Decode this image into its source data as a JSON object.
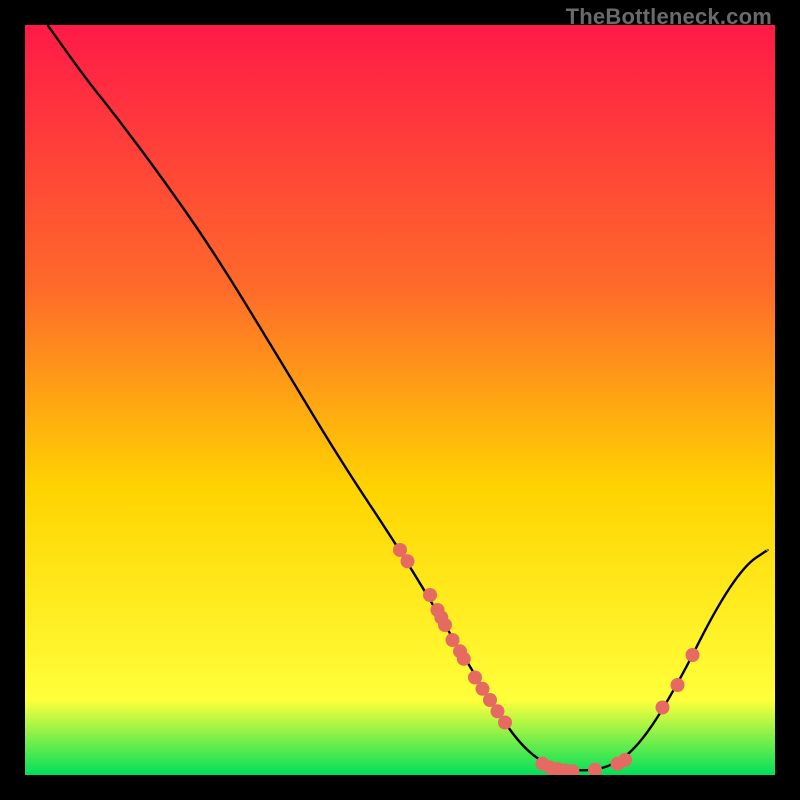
{
  "watermark": "TheBottleneck.com",
  "colors": {
    "black": "#000000",
    "curve": "#000000",
    "point": "#e56a61",
    "grad_top": "#ff1a47",
    "grad_mid1": "#ff6a2a",
    "grad_mid2": "#ffd400",
    "grad_mid3": "#ffff3a",
    "grad_bottom": "#00e05a"
  },
  "chart_data": {
    "type": "line",
    "title": "",
    "xlabel": "",
    "ylabel": "",
    "xlim": [
      0,
      100
    ],
    "ylim": [
      0,
      100
    ],
    "curve": [
      {
        "x": 3,
        "y": 100
      },
      {
        "x": 8,
        "y": 93
      },
      {
        "x": 12,
        "y": 88
      },
      {
        "x": 18,
        "y": 80
      },
      {
        "x": 25,
        "y": 70
      },
      {
        "x": 33,
        "y": 57
      },
      {
        "x": 42,
        "y": 42
      },
      {
        "x": 50,
        "y": 30
      },
      {
        "x": 56,
        "y": 20
      },
      {
        "x": 62,
        "y": 10
      },
      {
        "x": 66,
        "y": 4
      },
      {
        "x": 70,
        "y": 1
      },
      {
        "x": 74,
        "y": 0.5
      },
      {
        "x": 78,
        "y": 1
      },
      {
        "x": 82,
        "y": 4
      },
      {
        "x": 87,
        "y": 12
      },
      {
        "x": 92,
        "y": 22
      },
      {
        "x": 96,
        "y": 28
      },
      {
        "x": 99,
        "y": 30
      }
    ],
    "points": [
      {
        "x": 50,
        "y": 30
      },
      {
        "x": 51,
        "y": 28.5
      },
      {
        "x": 54,
        "y": 24
      },
      {
        "x": 55,
        "y": 22
      },
      {
        "x": 55.5,
        "y": 21
      },
      {
        "x": 56,
        "y": 20
      },
      {
        "x": 57,
        "y": 18
      },
      {
        "x": 58,
        "y": 16.5
      },
      {
        "x": 58.5,
        "y": 15.5
      },
      {
        "x": 60,
        "y": 13
      },
      {
        "x": 61,
        "y": 11.5
      },
      {
        "x": 62,
        "y": 10
      },
      {
        "x": 63,
        "y": 8.5
      },
      {
        "x": 64,
        "y": 7
      },
      {
        "x": 69,
        "y": 1.5
      },
      {
        "x": 70,
        "y": 1
      },
      {
        "x": 71,
        "y": 0.8
      },
      {
        "x": 72,
        "y": 0.6
      },
      {
        "x": 73,
        "y": 0.5
      },
      {
        "x": 76,
        "y": 0.7
      },
      {
        "x": 79,
        "y": 1.5
      },
      {
        "x": 80,
        "y": 2
      },
      {
        "x": 85,
        "y": 9
      },
      {
        "x": 87,
        "y": 12
      },
      {
        "x": 89,
        "y": 16
      }
    ]
  }
}
